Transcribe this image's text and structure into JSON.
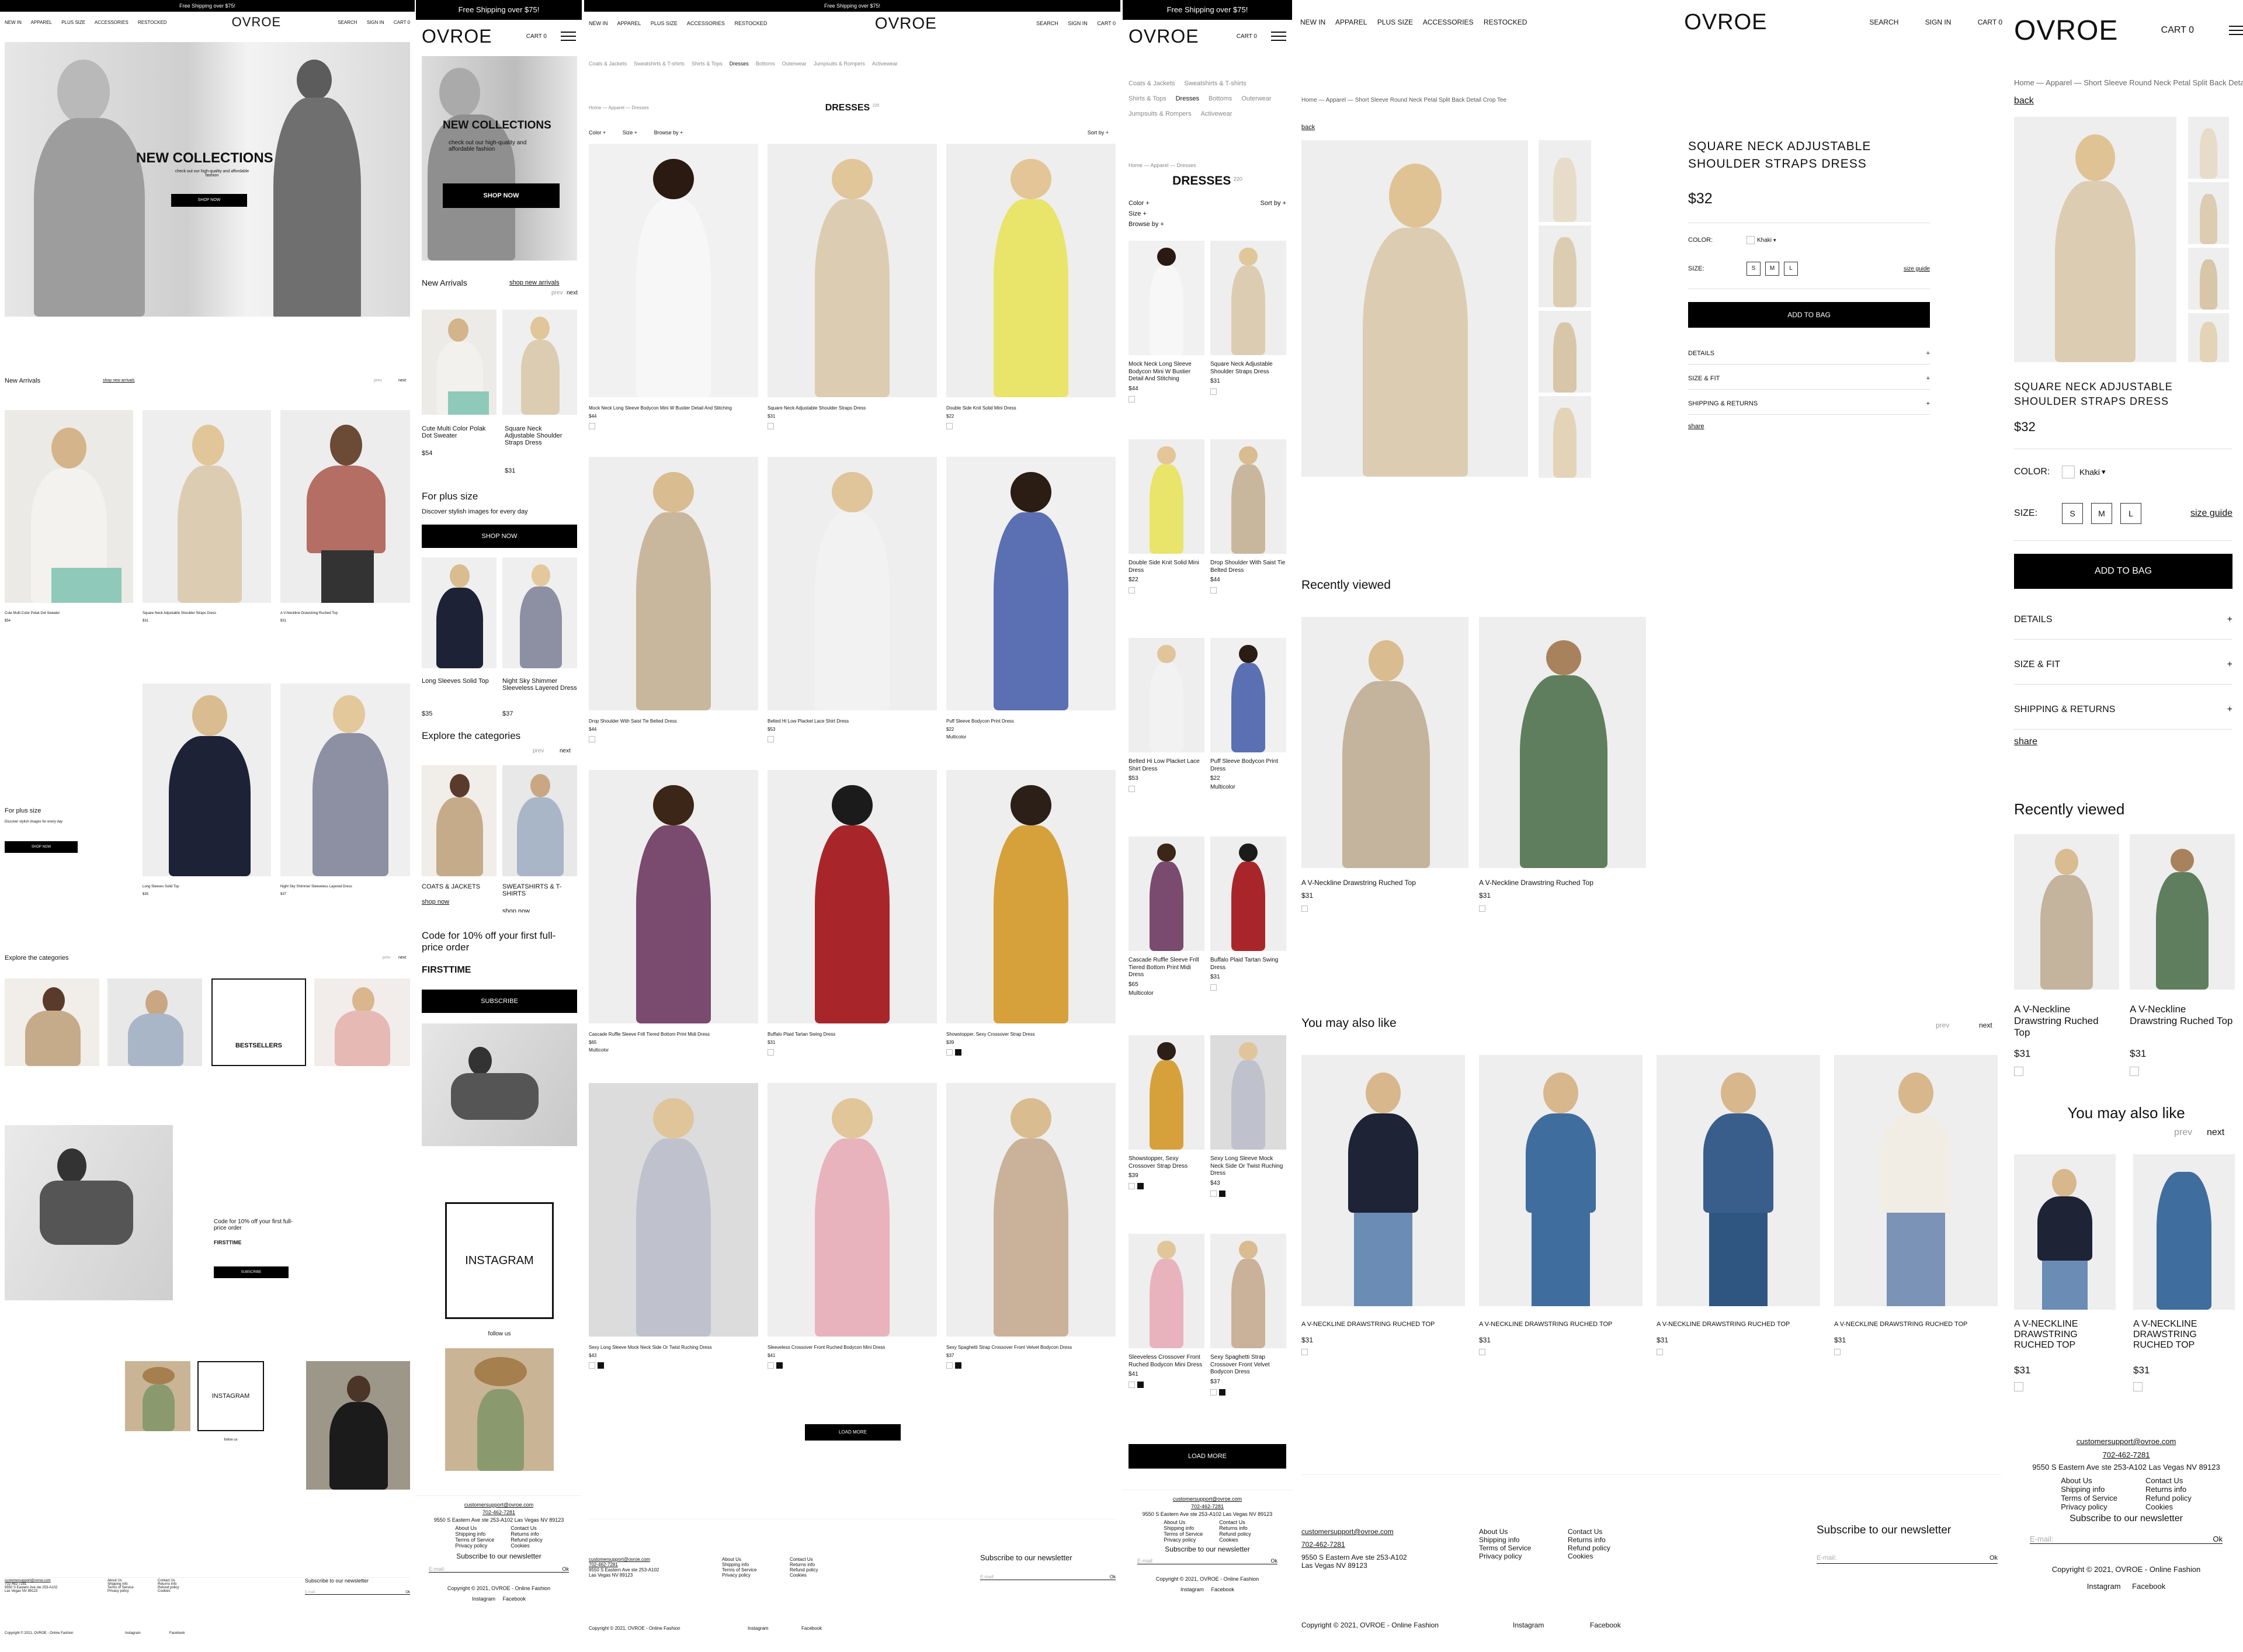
{
  "brand": "OVROE",
  "shipping_banner": "Free Shipping over $75!",
  "nav": {
    "new_in": "NEW IN",
    "apparel": "APPAREL",
    "plus_size": "PLUS SIZE",
    "accessories": "ACCESSORIES",
    "restocked": "RESTOCKED",
    "search": "SEARCH",
    "sign_in": "SIGN IN",
    "cart": "CART 0"
  },
  "hero": {
    "title": "NEW COLLECTIONS",
    "subtitle": "check out our high-quality and affordable fashion",
    "cta": "SHOP NOW"
  },
  "new_arrivals": {
    "title": "New Arrivals",
    "link": "shop new arrivals",
    "prev": "prev",
    "next": "next",
    "items": [
      {
        "name": "Cute Multi Color Polak Dot Sweater",
        "price": "$54"
      },
      {
        "name": "Square Neck Adjustable Shoulder Straps Dress",
        "price": "$31"
      },
      {
        "name": "A V-Neckline Drawstring Ruched Top",
        "price": "$31"
      }
    ]
  },
  "plus_size": {
    "title": "For plus size",
    "subtitle": "Discover stylish images for every day",
    "cta": "SHOP NOW",
    "items": [
      {
        "name": "Long Sleeves Solid Top",
        "price": "$35"
      },
      {
        "name": "Night Sky Shimmer Sleeveless Layered Dress",
        "price": "$37"
      }
    ]
  },
  "categories": {
    "title": "Explore the categories",
    "prev": "prev",
    "next": "next",
    "items": [
      {
        "name": "COATS & JACKETS",
        "link": "shop now"
      },
      {
        "name": "SWEATSHIRTS & T-SHIRTS",
        "link": "shop now"
      },
      {
        "name": "BESTSELLERS"
      }
    ]
  },
  "promo": {
    "text": "Code for 10% off your first full-price order",
    "code": "FIRSTTIME",
    "cta": "SUBSCRIBE"
  },
  "instagram": {
    "label": "INSTAGRAM",
    "follow": "follow us"
  },
  "footer": {
    "email": "customersupport@ovroe.com",
    "phone": "702-462-7281",
    "address1": "9550 S Eastern Ave ste 253-A102",
    "address2": "Las Vegas NV 89123",
    "address_full": "9550 S Eastern Ave ste 253-A102 Las Vegas NV 89123",
    "col1": [
      "About Us",
      "Shipping info",
      "Terms of Service",
      "Privacy policy"
    ],
    "col2": [
      "Contact Us",
      "Returns info",
      "Refund policy",
      "Cookies"
    ],
    "newsletter": "Subscribe to our newsletter",
    "email_placeholder": "E-mail:",
    "ok": "Ok",
    "copyright": "Copyright © 2021, OVROE - Online Fashion",
    "instagram": "Instagram",
    "facebook": "Facebook"
  },
  "listing": {
    "subnav": [
      "Coats & Jackets",
      "Sweatshirts & T-shirts",
      "Shirts & Tops",
      "Dresses",
      "Bottoms",
      "Outerwear",
      "Jumpsuits & Rompers",
      "Activewear"
    ],
    "breadcrumb": "Home — Apparel — Dresses",
    "title": "DRESSES",
    "count": "220",
    "filters": {
      "color": "Color +",
      "size": "Size +",
      "browse": "Browse by +",
      "sort": "Sort by +"
    },
    "load_more": "LOAD MORE",
    "products": [
      {
        "name": "Mock Neck Long Sleeve Bodycon Mini W Bustier Detail And Stitching",
        "price": "$44",
        "extra": ""
      },
      {
        "name": "Square Neck Adjustable Shoulder Straps Dress",
        "price": "$31",
        "extra": ""
      },
      {
        "name": "Double Side Knit Solid Mini Dress",
        "price": "$22",
        "extra": ""
      },
      {
        "name": "Drop Shoulder With Saist Tie Belted Dress",
        "price": "$44",
        "extra": ""
      },
      {
        "name": "Belted Hi Low Placket Lace Shirt Dress",
        "price": "$53",
        "extra": ""
      },
      {
        "name": "Puff Sleeve Bodycon Print Dress",
        "price": "$22",
        "extra": "Multicolor"
      },
      {
        "name": "Cascade Ruffle Sleeve Frill Tiered Bottom Print Midi Dress",
        "price": "$65",
        "extra": "Multicolor"
      },
      {
        "name": "Buffalo Plaid Tartan Swing Dress",
        "price": "$31",
        "extra": ""
      },
      {
        "name": "Showstopper, Sexy Crossover Strap Dress",
        "price": "$39",
        "extra": ""
      },
      {
        "name": "Sexy Long Sleeve Mock Neck Side Or Twist Ruching Dress",
        "price": "$43",
        "extra": ""
      },
      {
        "name": "Sleeveless Crossover Front Ruched Bodycon Mini Dress",
        "price": "$41",
        "extra": ""
      },
      {
        "name": "Sexy Spaghetti Strap Crossover Front Velvet Bodycon Dress",
        "price": "$37",
        "extra": ""
      }
    ]
  },
  "product": {
    "breadcrumb": "Home — Apparel — Short Sleeve Round Neck Petal Split Back Detail Crop Tee",
    "back": "back",
    "title": "SQUARE NECK ADJUSTABLE SHOULDER STRAPS DRESS",
    "price": "$32",
    "color_label": "COLOR:",
    "color_value": "Khaki",
    "size_label": "SIZE:",
    "sizes": [
      "S",
      "M",
      "L"
    ],
    "size_guide": "size guide",
    "add_to_bag": "ADD TO BAG",
    "accordions": [
      "DETAILS",
      "SIZE & FIT",
      "SHIPPING & RETURNS"
    ],
    "share": "share",
    "recently_viewed": {
      "title": "Recently viewed",
      "items": [
        {
          "name": "A V-Neckline Drawstring Ruched Top",
          "price": "$31"
        },
        {
          "name": "A V-Neckline Drawstring Ruched Top",
          "price": "$31"
        }
      ]
    },
    "also_like": {
      "title": "You may also like",
      "prev": "prev",
      "next": "next",
      "item_name": "A V-NECKLINE DRAWSTRING RUCHED TOP",
      "price": "$31"
    }
  },
  "colors": {
    "accent": "#000000",
    "text": "#111111",
    "muted": "#888888"
  }
}
